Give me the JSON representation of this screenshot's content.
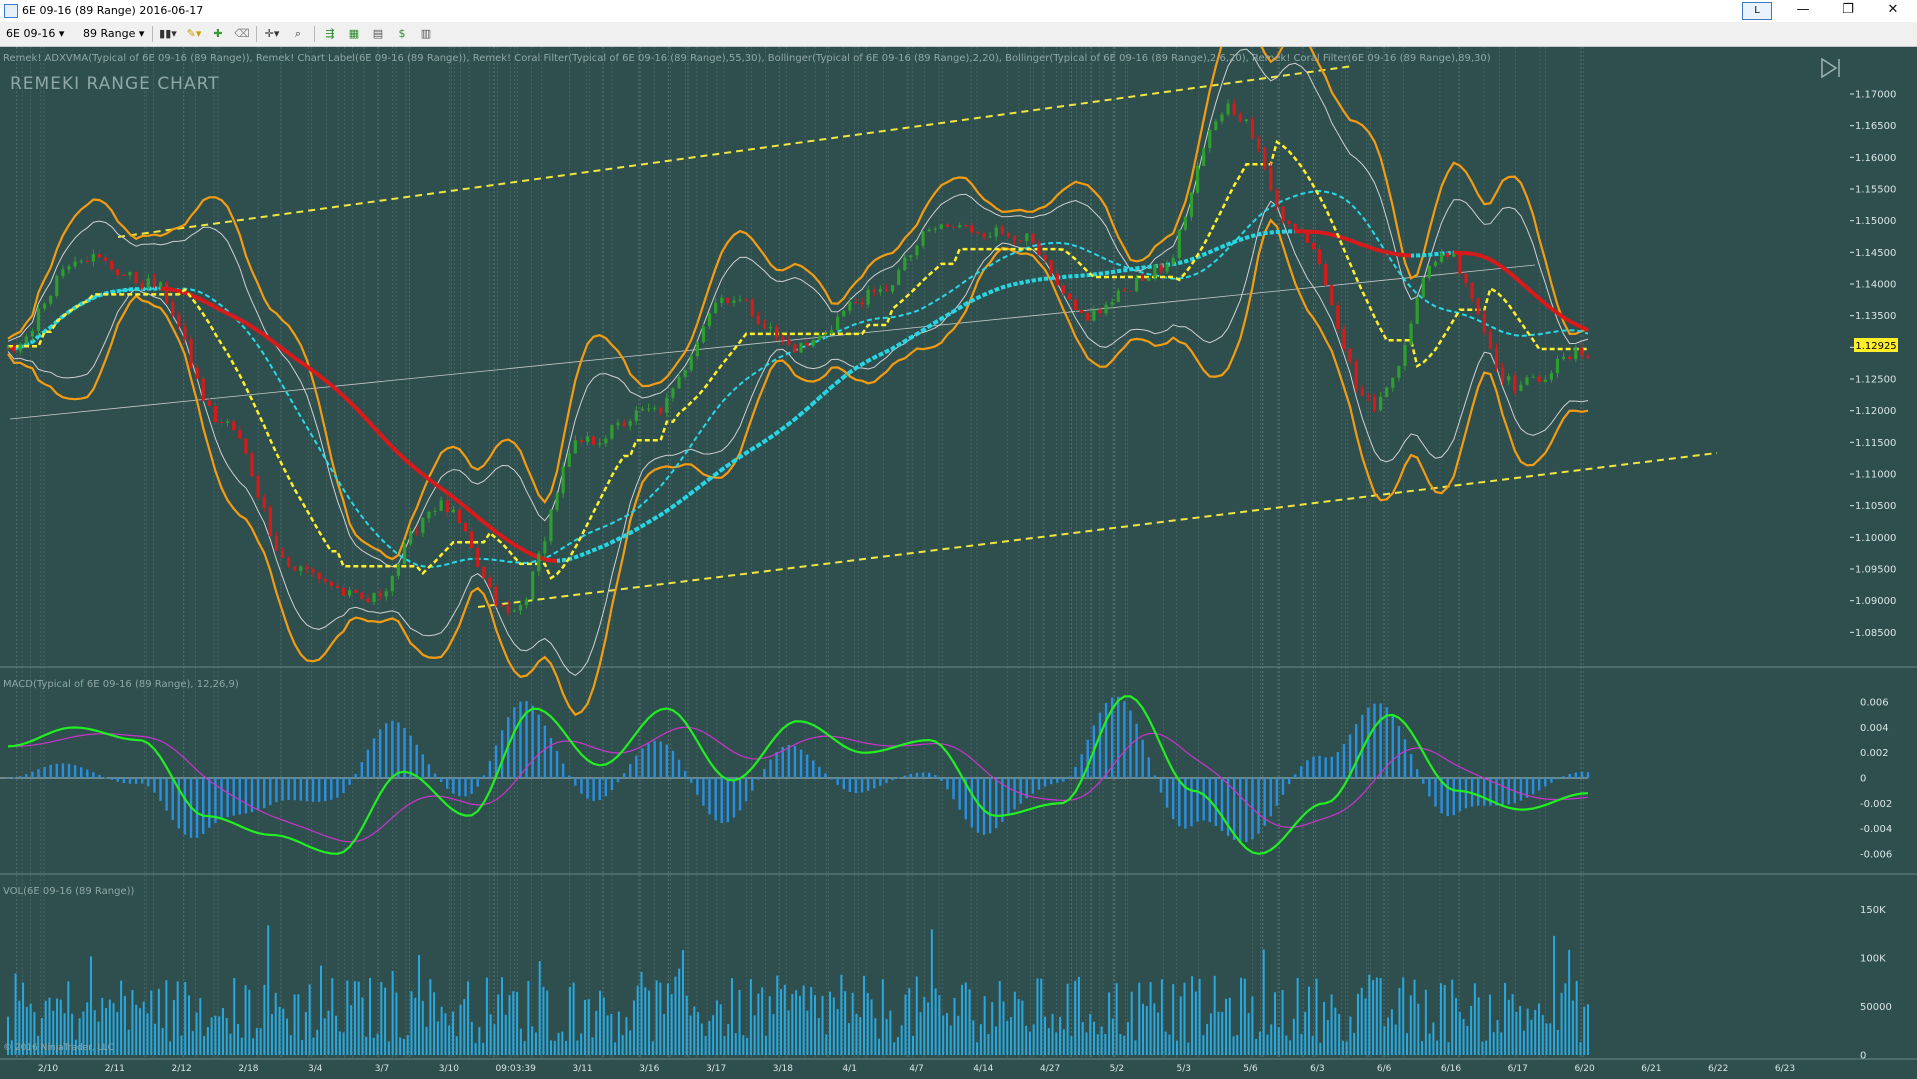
{
  "window": {
    "title": "6E 09-16 (89 Range)  2016-06-17",
    "layout_button": "L",
    "minimize_glyph": "—",
    "restore_glyph": "❐",
    "close_glyph": "✕"
  },
  "toolbar": {
    "instrument": "6E 09-16",
    "interval": "89 Range",
    "icons": [
      "bar-style-icon",
      "drawing-tool-icon",
      "pin-icon",
      "eraser-icon",
      "crosshair-icon",
      "zoom-icon",
      "strategies-icon",
      "chart-properties-icon",
      "indicators-icon",
      "data-box-icon",
      "properties-icon"
    ]
  },
  "colors": {
    "background": "#2f4f4f",
    "candle_up": "#2e9e2e",
    "candle_down": "#d61a1a",
    "bollinger_outer": "#f39c12",
    "bollinger_inner": "#d0d0d0",
    "coral_cyan": "#27d8e6",
    "coral_red": "#d81a1a",
    "adxvma_yellow": "#ffee2a",
    "channel_yellow": "#f0e640",
    "macd_line": "#22ee22",
    "macd_signal": "#cc33cc",
    "macd_hist": "#2b8fe0",
    "volume": "#2aa8de"
  },
  "price_panel": {
    "indicator_legend": "Remek! ADXVMA(Typical of 6E 09-16 (89 Range)), Remek! Chart Label(6E 09-16 (89 Range)), Remek! Coral Filter(Typical of 6E 09-16 (89 Range),55,30), Bollinger(Typical of 6E 09-16 (89 Range),2,20), Bollinger(Typical of 6E 09-16 (89 Range),2.6,20), Remek! Coral Filter(6E 09-16 (89 Range),89,30)",
    "chart_label": "REMEKI RANGE CHART",
    "last_price": "1.12925"
  },
  "macd_panel": {
    "title": "MACD(Typical of 6E 09-16 (89 Range), 12,26,9)"
  },
  "volume_panel": {
    "title": "VOL(6E 09-16 (89 Range))"
  },
  "copyright": "© 2016 NinjaTrader, LLC",
  "chart_data": [
    {
      "type": "line",
      "panel": "price",
      "ylim": [
        1.083,
        1.173
      ],
      "y_ticks": [
        "1.17000",
        "1.16500",
        "1.16000",
        "1.15500",
        "1.15000",
        "1.14500",
        "1.14000",
        "1.13500",
        "1.13000",
        "1.12500",
        "1.12000",
        "1.11500",
        "1.11000",
        "1.10500",
        "1.10000",
        "1.09500",
        "1.09000",
        "1.08500"
      ],
      "x": [
        "2/10",
        "2/11",
        "2/12",
        "2/18",
        "3/4",
        "3/7",
        "3/10",
        "09:03:39",
        "3/11",
        "3/16",
        "3/17",
        "3/18",
        "4/1",
        "4/7",
        "4/14",
        "4/27",
        "5/2",
        "5/3",
        "5/6",
        "6/3",
        "6/6",
        "6/16",
        "6/17",
        "6/20",
        "6/21",
        "6/22",
        "6/23"
      ],
      "series": [
        {
          "values": [
            1.1295,
            1.1445,
            1.14,
            1.118,
            1.095,
            1.09,
            1.105,
            1.088,
            1.115,
            1.12,
            1.138,
            1.13,
            1.138,
            1.149,
            1.148,
            1.135,
            1.142,
            1.168,
            1.148,
            1.121,
            1.145,
            1.124,
            1.12925
          ]
        }
      ],
      "grid": true
    },
    {
      "type": "line",
      "panel": "macd",
      "ylim": [
        -0.0072,
        0.0072
      ],
      "y_ticks": [
        "0.006",
        "0.004",
        "0.002",
        "0",
        "-0.002",
        "-0.004",
        "-0.006"
      ],
      "series": [
        {
          "values": [
            0.0025,
            0.004,
            0.003,
            -0.003,
            -0.0045,
            -0.006,
            0.0005,
            -0.003,
            0.0055,
            0.001,
            0.0055,
            -0.0002,
            0.0045,
            0.002,
            0.003,
            -0.003,
            -0.002,
            0.0065,
            -0.001,
            -0.006,
            -0.002,
            0.005,
            -0.001,
            -0.0025,
            -0.0012
          ]
        }
      ]
    },
    {
      "type": "bar",
      "panel": "volume",
      "ylim": [
        0,
        165000
      ],
      "y_ticks": [
        "150K",
        "100K",
        "50000",
        "0"
      ]
    }
  ]
}
